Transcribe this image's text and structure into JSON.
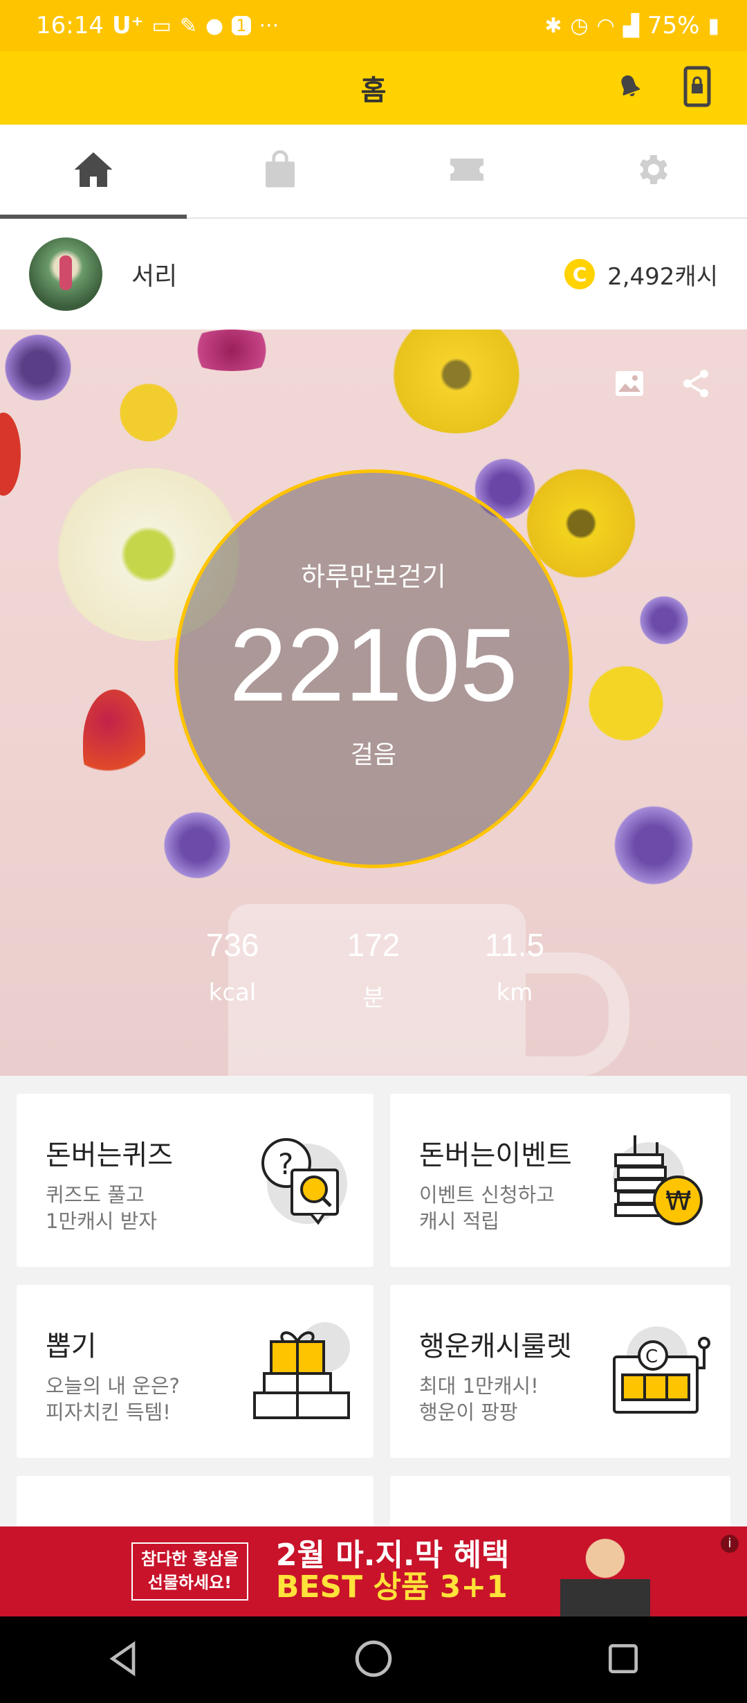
{
  "status_bar": {
    "time": "16:14",
    "carrier": "U⁺",
    "battery": "75%"
  },
  "header": {
    "title": "홈"
  },
  "tabs": [
    {
      "icon": "home-icon",
      "active": true
    },
    {
      "icon": "shopping-bag-icon",
      "active": false
    },
    {
      "icon": "ticket-icon",
      "active": false
    },
    {
      "icon": "gear-icon",
      "active": false
    }
  ],
  "profile": {
    "name": "서리",
    "cash": "2,492캐시",
    "coin_symbol": "C"
  },
  "hero": {
    "label": "하루만보걷기",
    "steps": "22105",
    "unit": "걸음",
    "stats": [
      {
        "value": "736",
        "unit": "kcal"
      },
      {
        "value": "172",
        "unit": "분"
      },
      {
        "value": "11.5",
        "unit": "km"
      }
    ]
  },
  "cards": [
    {
      "title": "돈버는퀴즈",
      "desc": "퀴즈도 풀고\n1만캐시 받자",
      "icon": "quiz-icon"
    },
    {
      "title": "돈버는이벤트",
      "desc": "이벤트 신청하고\n캐시 적립",
      "icon": "coins-icon"
    },
    {
      "title": "뽑기",
      "desc": "오늘의 내 운은?\n피자치킨 득템!",
      "icon": "gift-icon"
    },
    {
      "title": "행운캐시룰렛",
      "desc": "최대 1만캐시!\n행운이 팡팡",
      "icon": "slot-machine-icon"
    }
  ],
  "ad": {
    "box_line1": "참다한 홍삼을",
    "box_line2": "선물하세요!",
    "headline": "2월 마.지.막 혜택",
    "sub": "BEST 상품 3+1",
    "info": "i"
  },
  "colors": {
    "accent": "#ffc400",
    "header_bg": "#ffd200",
    "ad_bg": "#c8132a"
  }
}
